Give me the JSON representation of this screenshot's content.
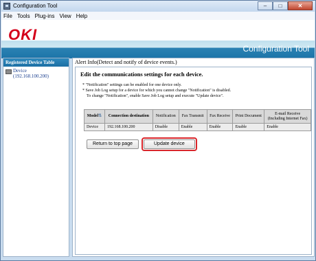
{
  "window": {
    "title": "Configuration Tool",
    "controls": {
      "minimize": "–",
      "maximize": "□",
      "close": "✕"
    }
  },
  "menu": [
    "File",
    "Tools",
    "Plug-ins",
    "View",
    "Help"
  ],
  "banner": {
    "logo": "OKI",
    "title": "Configuration Tool"
  },
  "sidebar": {
    "header": "Registered Device Table",
    "device_name": "Device",
    "device_address": "(192.168.100.200)"
  },
  "main": {
    "title": "Alert Info(Detect and notify of device events.)",
    "heading": "Edit the communications settings for each device.",
    "notes": [
      "* \"Notification\" settings can be enabled for one device only.",
      "* Save Job Log setup for a device for which you cannot change \"Notification\" is disabled.",
      "To change \"Notification\", enable Save Job Log setup and execute \"Update device\"."
    ],
    "table": {
      "headers": [
        "Model",
        "Connection destination",
        "Notification",
        "Fax Transmit",
        "Fax Receive",
        "Print Document",
        "E-mail Receive",
        "(Including Internet Fax)"
      ],
      "row": [
        "Device",
        "192.168.100.200",
        "Disable",
        "Enable",
        "Enable",
        "Enable",
        "Enable"
      ]
    },
    "buttons": {
      "return": "Return to top page",
      "update": "Update device"
    }
  },
  "colors": {
    "accent": "#1c74a8",
    "logo": "#d4001a",
    "highlight": "#d9262b"
  }
}
